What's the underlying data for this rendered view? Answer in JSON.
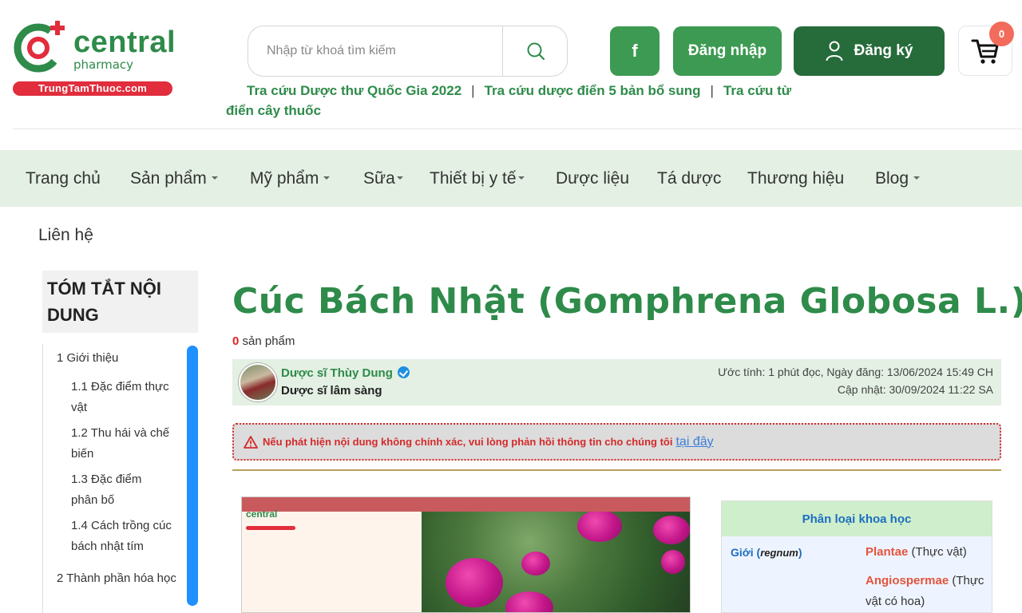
{
  "header": {
    "logo": {
      "name": "central",
      "sub": "pharmacy",
      "domain": "TrungTamThuoc.com"
    },
    "search": {
      "placeholder": "Nhập từ khoá tìm kiếm"
    },
    "facebook_label": "f",
    "login_label": "Đăng nhập",
    "register_label": "Đăng ký",
    "cart_count": "0",
    "quick_links": [
      "Tra cứu Dược thư Quốc Gia 2022",
      "Tra cứu dược điển 5 bản bổ sung",
      "Tra cứu từ điển cây thuốc"
    ],
    "quick_link_separator": "|"
  },
  "nav": {
    "items": [
      {
        "label": "Trang chủ"
      },
      {
        "label": "Sản phẩm"
      },
      {
        "label": "Mỹ phẩm"
      },
      {
        "label": "Sữa"
      },
      {
        "label": "Thiết bị y tế"
      },
      {
        "label": "Dược liệu"
      },
      {
        "label": "Tá dược"
      },
      {
        "label": "Thương hiệu"
      },
      {
        "label": "Blog"
      }
    ],
    "contact": "Liên hệ"
  },
  "toc": {
    "title": "TÓM TẮT NỘI DUNG",
    "items": [
      "1   Giới thiệu",
      "1.1   Đặc điểm thực vật",
      "1.2   Thu hái và chế biến",
      "1.3   Đặc điểm phân bố",
      "1.4   Cách trồng cúc bách nhật tím",
      "2   Thành phần hóa học"
    ]
  },
  "article": {
    "title": "Cúc Bách Nhật (Gomphrena Globosa L.)",
    "product_count": "0",
    "product_label": "sản phẩm",
    "author": {
      "name": "Dược sĩ Thùy Dung",
      "role": "Dược sĩ lâm sàng",
      "meta_read": "Ước tính: 1 phút đọc, Ngày đăng: 13/06/2024 15:49 CH",
      "meta_update": "Cập nhật: 30/09/2024 11:22 SA"
    },
    "warning": {
      "text": "Nếu phát hiện nội dung không chính xác, vui lòng phản hồi thông tin cho chúng tôi",
      "link": "tại đây"
    },
    "figure_logo": "central"
  },
  "classification": {
    "title": "Phân loại khoa học",
    "rows": [
      {
        "key": "Giới",
        "key_latin": "regnum",
        "val_main": "Plantae",
        "val_sub": "(Thực vật)"
      },
      {
        "key": "",
        "key_latin": "",
        "val_main": "Angiospermae",
        "val_sub": "(Thực vật có hoa)"
      }
    ]
  },
  "colors": {
    "brand_green": "#2e8b4a",
    "dark_green": "#266b3a",
    "nav_bg": "#e3f0e3",
    "accent_red": "#d42a2a",
    "link_blue": "#1c6ec0"
  }
}
